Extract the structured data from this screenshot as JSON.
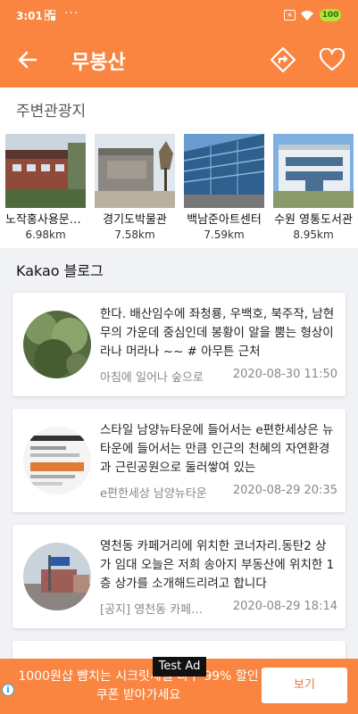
{
  "status_bar": {
    "time": "3:01",
    "dots": "···",
    "battery": "100"
  },
  "app_bar": {
    "title": "무봉산"
  },
  "nearby": {
    "section_title": "주변관광지",
    "items": [
      {
        "name": "노작홍사용문학관",
        "distance": "6.98km"
      },
      {
        "name": "경기도박물관",
        "distance": "7.58km"
      },
      {
        "name": "백남준아트센터",
        "distance": "7.59km"
      },
      {
        "name": "수원 영통도서관",
        "distance": "8.95km"
      }
    ]
  },
  "blog": {
    "section_title": "Kakao 블로그",
    "posts": [
      {
        "snippet": "한다. 배산임수에 좌청룡, 우백호, 북주작, 남현무의 가운데 중심인데 봉황이 알을 뿜는 형상이라나 머라나 ~~ # 아무튼 근처",
        "author": "아침에 일어나 숲으로",
        "date": "2020-08-30 11:50"
      },
      {
        "snippet": "스타일 남양뉴타운에 들어서는 e편한세상은 뉴타운에 들어서는 만큼 인근의 천혜의 자연환경과 근린공원으로 둘러쌓여 있는",
        "author": "e편한세상 남양뉴타운",
        "date": "2020-08-29 20:35"
      },
      {
        "snippet": "영천동 카페거리에 위치한 코너자리.동탄2 상가 임대 오늘은 저희 송아지 부동산에 위치한 1층 상가를 소개해드리려고 합니다",
        "author": "[공지] 영천동 카페거리",
        "date": "2020-08-29 18:14"
      }
    ]
  },
  "ad": {
    "text": "1000원샵 뺨치는 시크릿세일 다구 99% 할인 쿠폰 받아가세요",
    "button": "보기",
    "label": "Test Ad",
    "info": "i"
  },
  "colors": {
    "accent": "#f98540",
    "background": "#f0f2f5"
  }
}
